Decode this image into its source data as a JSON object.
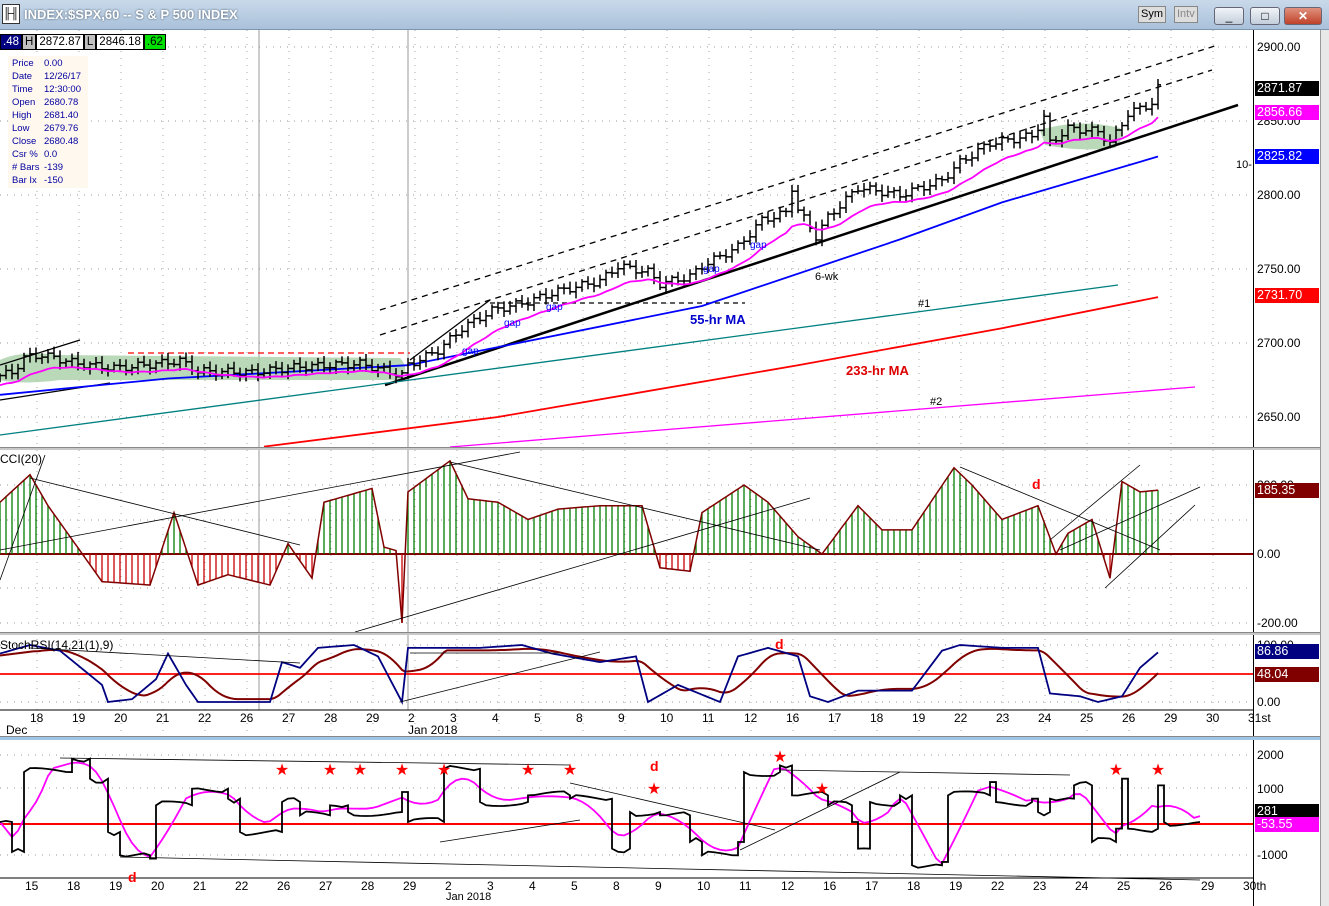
{
  "window": {
    "title": "INDEX:$SPX,60 -- S & P 500 INDEX",
    "sym_label": "Sym",
    "intv_label": "Intv",
    "minimize": "_",
    "maximize": "□",
    "close": "✕"
  },
  "quote": {
    "last": ".48",
    "h_label": "H",
    "high": "2872.87",
    "l_label": "L",
    "low": "2846.18",
    "chg": ".62"
  },
  "info": [
    [
      "Price",
      "0.00"
    ],
    [
      "Date",
      "12/26/17"
    ],
    [
      "Time",
      "12:30:00"
    ],
    [
      "Open",
      "2680.78"
    ],
    [
      "High",
      "2681.40"
    ],
    [
      "Low",
      "2679.76"
    ],
    [
      "Close",
      "2680.48"
    ],
    [
      "Csr %",
      "0.0"
    ],
    [
      "# Bars",
      "-139"
    ],
    [
      "Bar Ix",
      "-150"
    ]
  ],
  "colors": {
    "price": "#000000",
    "ma_short": "#ff00ff",
    "ma55": "#0000ff",
    "ma233": "#ff0000",
    "cci_up": "#008000",
    "cci_down": "#cc0000",
    "cci_line": "#800000",
    "stoch_k": "#000080",
    "stoch_d": "#800000"
  },
  "annotations": {
    "gap": "gap",
    "ma55": "55-hr MA",
    "ma233": "233-hr MA",
    "sixwk": "6-wk",
    "n1": "#1",
    "n2": "#2",
    "tenwk": "10-",
    "d": "d"
  },
  "chart_data": [
    {
      "type": "line",
      "title": "INDEX:$SPX,60",
      "xunit": "hourly bar index",
      "ylim": [
        2630,
        2915
      ],
      "yticks": [
        "2900.00",
        "2850.00",
        "2800.00",
        "2750.00",
        "2700.00",
        "2650.00"
      ],
      "last_labels": {
        "price": "2871.87",
        "ma_short": "2856.66",
        "ma55": "2825.82",
        "ma233": "2731.70"
      },
      "price_keypoints": [
        [
          0,
          2678
        ],
        [
          2,
          2680
        ],
        [
          4,
          2690
        ],
        [
          7,
          2692
        ],
        [
          13,
          2686
        ],
        [
          19,
          2683
        ],
        [
          22,
          2684
        ],
        [
          30,
          2688
        ],
        [
          33,
          2681
        ],
        [
          42,
          2680
        ],
        [
          50,
          2684
        ],
        [
          60,
          2686
        ],
        [
          67,
          2678
        ],
        [
          68,
          2685
        ],
        [
          73,
          2695
        ],
        [
          77,
          2710
        ],
        [
          82,
          2722
        ],
        [
          88,
          2728
        ],
        [
          93,
          2735
        ],
        [
          100,
          2742
        ],
        [
          103,
          2752
        ],
        [
          108,
          2748
        ],
        [
          110,
          2740
        ],
        [
          115,
          2745
        ],
        [
          117,
          2752
        ],
        [
          123,
          2765
        ],
        [
          127,
          2783
        ],
        [
          131,
          2788
        ],
        [
          132,
          2805
        ],
        [
          133,
          2790
        ],
        [
          136,
          2772
        ],
        [
          138,
          2785
        ],
        [
          143,
          2805
        ],
        [
          150,
          2800
        ],
        [
          157,
          2810
        ],
        [
          160,
          2822
        ],
        [
          165,
          2835
        ],
        [
          172,
          2840
        ],
        [
          174,
          2852
        ],
        [
          175,
          2835
        ],
        [
          178,
          2845
        ],
        [
          183,
          2843
        ],
        [
          185,
          2835
        ],
        [
          188,
          2855
        ],
        [
          192,
          2862
        ],
        [
          193,
          2872
        ]
      ],
      "ma55": [
        [
          0,
          2665
        ],
        [
          28,
          2676
        ],
        [
          68,
          2685
        ],
        [
          117,
          2725
        ],
        [
          150,
          2770
        ],
        [
          167,
          2795
        ],
        [
          193,
          2826
        ]
      ],
      "ma233": [
        [
          44,
          2630
        ],
        [
          83,
          2650
        ],
        [
          133,
          2685
        ],
        [
          167,
          2710
        ],
        [
          193,
          2731
        ]
      ],
      "xticks": [
        "18",
        "19",
        "20",
        "21",
        "22",
        "26",
        "27",
        "28",
        "29",
        "2",
        "3",
        "4",
        "5",
        "8",
        "9",
        "10",
        "11",
        "12",
        "16",
        "17",
        "18",
        "19",
        "22",
        "23",
        "24",
        "25",
        "26",
        "29",
        "30",
        "31st"
      ],
      "xsub": [
        "Dec",
        "Jan 2018"
      ]
    },
    {
      "type": "bar",
      "title": "CCI(20)",
      "ylim": [
        -220,
        280
      ],
      "yticks": [
        "200.00",
        "0.00",
        "-200.00"
      ],
      "last_label": "185.35",
      "keypoints": [
        [
          0,
          150
        ],
        [
          5,
          230
        ],
        [
          8,
          140
        ],
        [
          17,
          -80
        ],
        [
          25,
          -90
        ],
        [
          29,
          120
        ],
        [
          33,
          -90
        ],
        [
          38,
          -60
        ],
        [
          45,
          -90
        ],
        [
          48,
          30
        ],
        [
          52,
          -70
        ],
        [
          54,
          150
        ],
        [
          62,
          190
        ],
        [
          64,
          20
        ],
        [
          66,
          10
        ],
        [
          67,
          -200
        ],
        [
          68,
          180
        ],
        [
          75,
          270
        ],
        [
          78,
          160
        ],
        [
          83,
          150
        ],
        [
          88,
          100
        ],
        [
          93,
          130
        ],
        [
          100,
          140
        ],
        [
          107,
          140
        ],
        [
          110,
          -40
        ],
        [
          115,
          -50
        ],
        [
          117,
          120
        ],
        [
          124,
          200
        ],
        [
          128,
          150
        ],
        [
          133,
          50
        ],
        [
          137,
          0
        ],
        [
          143,
          140
        ],
        [
          147,
          70
        ],
        [
          152,
          70
        ],
        [
          159,
          250
        ],
        [
          162,
          200
        ],
        [
          167,
          100
        ],
        [
          173,
          140
        ],
        [
          176,
          0
        ],
        [
          178,
          60
        ],
        [
          182,
          100
        ],
        [
          185,
          -70
        ],
        [
          187,
          210
        ],
        [
          190,
          180
        ],
        [
          193,
          185
        ]
      ]
    },
    {
      "type": "line",
      "title": "StochRSI(14,21(1),9)",
      "ylim": [
        0,
        100
      ],
      "yticks": [
        "100.00",
        "0.00"
      ],
      "last_labels": {
        "k": "86.86",
        "d": "48.04"
      },
      "k_keypoints": [
        [
          0,
          85
        ],
        [
          5,
          100
        ],
        [
          10,
          90
        ],
        [
          17,
          30
        ],
        [
          18,
          0
        ],
        [
          22,
          5
        ],
        [
          26,
          40
        ],
        [
          28,
          85
        ],
        [
          31,
          30
        ],
        [
          33,
          0
        ],
        [
          45,
          0
        ],
        [
          47,
          70
        ],
        [
          50,
          60
        ],
        [
          53,
          95
        ],
        [
          59,
          100
        ],
        [
          63,
          80
        ],
        [
          67,
          0
        ],
        [
          68,
          95
        ],
        [
          80,
          95
        ],
        [
          87,
          100
        ],
        [
          92,
          85
        ],
        [
          100,
          70
        ],
        [
          106,
          80
        ],
        [
          108,
          0
        ],
        [
          113,
          30
        ],
        [
          120,
          0
        ],
        [
          123,
          80
        ],
        [
          128,
          95
        ],
        [
          133,
          80
        ],
        [
          135,
          10
        ],
        [
          138,
          0
        ],
        [
          143,
          20
        ],
        [
          152,
          20
        ],
        [
          157,
          90
        ],
        [
          160,
          100
        ],
        [
          167,
          95
        ],
        [
          173,
          95
        ],
        [
          175,
          15
        ],
        [
          180,
          10
        ],
        [
          183,
          0
        ],
        [
          187,
          10
        ],
        [
          190,
          60
        ],
        [
          193,
          87
        ]
      ]
    },
    {
      "type": "line",
      "title": "breadth oscillator",
      "ylim": [
        -1500,
        2100
      ],
      "yticks": [
        "2000",
        "1000",
        "-1000"
      ],
      "last_labels": {
        "line": "281",
        "avg": "-53.55"
      },
      "keypoints": [
        [
          0,
          0
        ],
        [
          2,
          -900
        ],
        [
          4,
          1500
        ],
        [
          12,
          1900
        ],
        [
          15,
          1300
        ],
        [
          18,
          -300
        ],
        [
          20,
          -1000
        ],
        [
          25,
          -1100
        ],
        [
          26,
          500
        ],
        [
          32,
          1000
        ],
        [
          38,
          700
        ],
        [
          40,
          -300
        ],
        [
          47,
          600
        ],
        [
          50,
          200
        ],
        [
          55,
          500
        ],
        [
          58,
          300
        ],
        [
          67,
          900
        ],
        [
          68,
          0
        ],
        [
          74,
          1600
        ],
        [
          80,
          600
        ],
        [
          88,
          800
        ],
        [
          95,
          700
        ],
        [
          102,
          -800
        ],
        [
          105,
          300
        ],
        [
          110,
          200
        ],
        [
          115,
          -600
        ],
        [
          117,
          -1000
        ],
        [
          123,
          -600
        ],
        [
          124,
          1500
        ],
        [
          130,
          1700
        ],
        [
          132,
          800
        ],
        [
          138,
          500
        ],
        [
          142,
          0
        ],
        [
          143,
          -800
        ],
        [
          145,
          600
        ],
        [
          150,
          800
        ],
        [
          152,
          -1300
        ],
        [
          157,
          -1200
        ],
        [
          158,
          800
        ],
        [
          165,
          1200
        ],
        [
          166,
          600
        ],
        [
          172,
          700
        ],
        [
          173,
          300
        ],
        [
          175,
          700
        ],
        [
          179,
          1100
        ],
        [
          182,
          -600
        ],
        [
          186,
          -200
        ],
        [
          187,
          1300
        ],
        [
          188,
          -200
        ],
        [
          193,
          1100
        ],
        [
          194,
          0
        ],
        [
          200,
          300
        ]
      ],
      "stars": [
        47,
        55,
        60,
        67,
        74,
        88,
        95,
        109,
        130,
        137,
        186,
        193
      ],
      "xticks": [
        "15",
        "18",
        "19",
        "20",
        "21",
        "22",
        "26",
        "27",
        "28",
        "29",
        "2",
        "3",
        "4",
        "5",
        "8",
        "9",
        "10",
        "11",
        "12",
        "16",
        "17",
        "18",
        "19",
        "22",
        "23",
        "24",
        "25",
        "26",
        "29",
        "30th"
      ],
      "xsub": "Jan 2018"
    }
  ]
}
